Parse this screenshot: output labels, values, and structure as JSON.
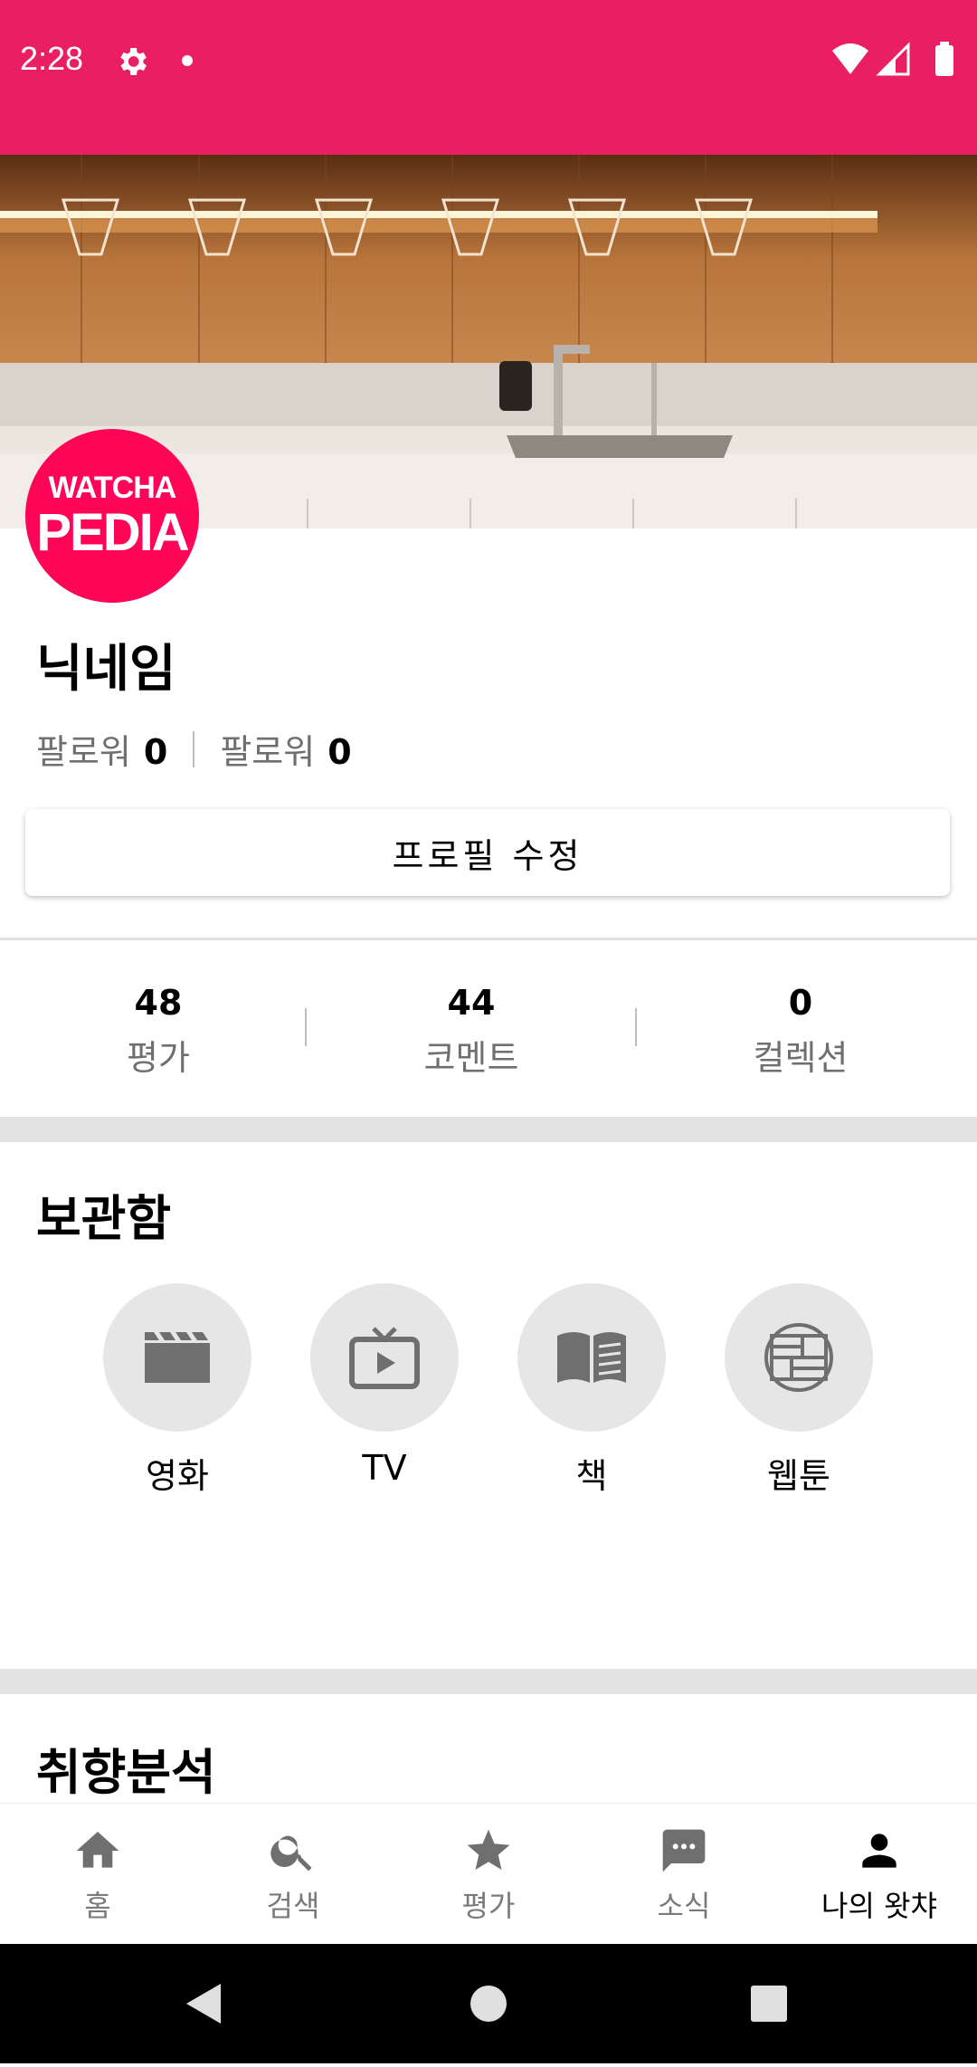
{
  "status_bar": {
    "time": "2:28"
  },
  "profile": {
    "avatar_line1": "WATCHA",
    "avatar_line2": "PEDIA",
    "nickname": "닉네임",
    "followers_label": "팔로워",
    "followers_count": "0",
    "following_label": "팔로워",
    "following_count": "0",
    "edit_button": "프로필 수정"
  },
  "stats": [
    {
      "value": "48",
      "label": "평가"
    },
    {
      "value": "44",
      "label": "코멘트"
    },
    {
      "value": "0",
      "label": "컬렉션"
    }
  ],
  "storage": {
    "title": "보관함",
    "items": [
      {
        "label": "영화",
        "icon": "movie-clapper-icon"
      },
      {
        "label": "TV",
        "icon": "tv-icon"
      },
      {
        "label": "책",
        "icon": "book-icon"
      },
      {
        "label": "웹툰",
        "icon": "webtoon-icon"
      }
    ]
  },
  "taste": {
    "title": "취향분석"
  },
  "bottom_nav": [
    {
      "label": "홈",
      "icon": "home-icon",
      "active": false
    },
    {
      "label": "검색",
      "icon": "search-icon",
      "active": false
    },
    {
      "label": "평가",
      "icon": "star-icon",
      "active": false
    },
    {
      "label": "소식",
      "icon": "chat-icon",
      "active": false
    },
    {
      "label": "나의 왓챠",
      "icon": "person-icon",
      "active": true
    }
  ],
  "colors": {
    "status_bar": "#e91e63",
    "avatar": "#ff0558",
    "icon_grey": "#6f6f6f"
  }
}
